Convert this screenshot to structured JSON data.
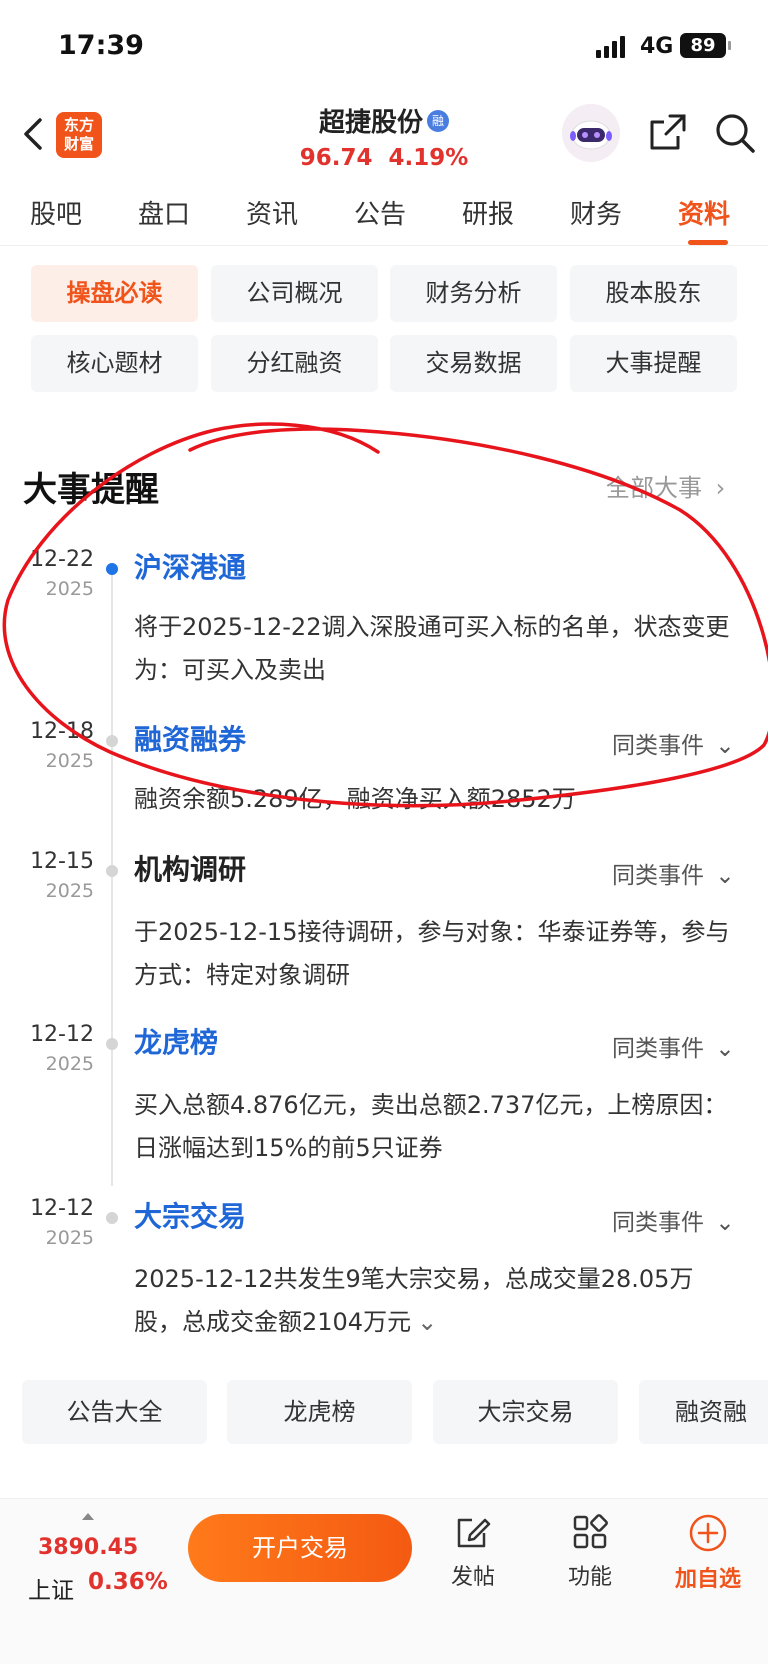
{
  "status_bar": {
    "time": "17:39",
    "network": "4G",
    "battery": "89"
  },
  "header": {
    "logo_line1": "东方",
    "logo_line2": "财富",
    "stock_name": "超捷股份",
    "rong_badge": "融",
    "price": "96.74",
    "change_pct": "4.19%"
  },
  "tabs": [
    {
      "label": "股吧"
    },
    {
      "label": "盘口"
    },
    {
      "label": "资讯"
    },
    {
      "label": "公告"
    },
    {
      "label": "研报"
    },
    {
      "label": "财务"
    },
    {
      "label": "资料",
      "active": true
    }
  ],
  "chips": [
    {
      "label": "操盘必读",
      "active": true
    },
    {
      "label": "公司概况"
    },
    {
      "label": "财务分析"
    },
    {
      "label": "股本股东"
    },
    {
      "label": "核心题材"
    },
    {
      "label": "分红融资"
    },
    {
      "label": "交易数据"
    },
    {
      "label": "大事提醒"
    }
  ],
  "section": {
    "title": "大事提醒",
    "all_link": "全部大事"
  },
  "events": [
    {
      "date": "12-22",
      "year": "2025",
      "title": "沪深港通",
      "desc": "将于2025-12-22调入深股通可买入标的名单，状态变更为：可买入及卖出"
    },
    {
      "date": "12-18",
      "year": "2025",
      "title": "融资融券",
      "similar": "同类事件",
      "desc": "融资余额5.289亿，融资净买入额2852万"
    },
    {
      "date": "12-15",
      "year": "2025",
      "title": "机构调研",
      "similar": "同类事件",
      "desc": "于2025-12-15接待调研，参与对象：华泰证券等，参与方式：特定对象调研"
    },
    {
      "date": "12-12",
      "year": "2025",
      "title": "龙虎榜",
      "similar": "同类事件",
      "desc": "买入总额4.876亿元，卖出总额2.737亿元，上榜原因：日涨幅达到15%的前5只证券"
    },
    {
      "date": "12-12",
      "year": "2025",
      "title": "大宗交易",
      "similar": "同类事件",
      "desc": "2025-12-12共发生9笔大宗交易，总成交量28.05万股，总成交金额2104万元"
    }
  ],
  "bottom_chips": [
    {
      "label": "公告大全"
    },
    {
      "label": "龙虎榜"
    },
    {
      "label": "大宗交易"
    },
    {
      "label": "融资融"
    }
  ],
  "bottom_bar": {
    "index_value": "3890.45",
    "index_name": "上证",
    "index_change": "0.36%",
    "trade_button": "开户交易",
    "post_label": "发帖",
    "func_label": "功能",
    "add_label": "加自选"
  },
  "colors": {
    "accent": "#f0541b",
    "rise": "#e1322d",
    "link_blue": "#1f66d6",
    "annotation": "#e8141c"
  }
}
